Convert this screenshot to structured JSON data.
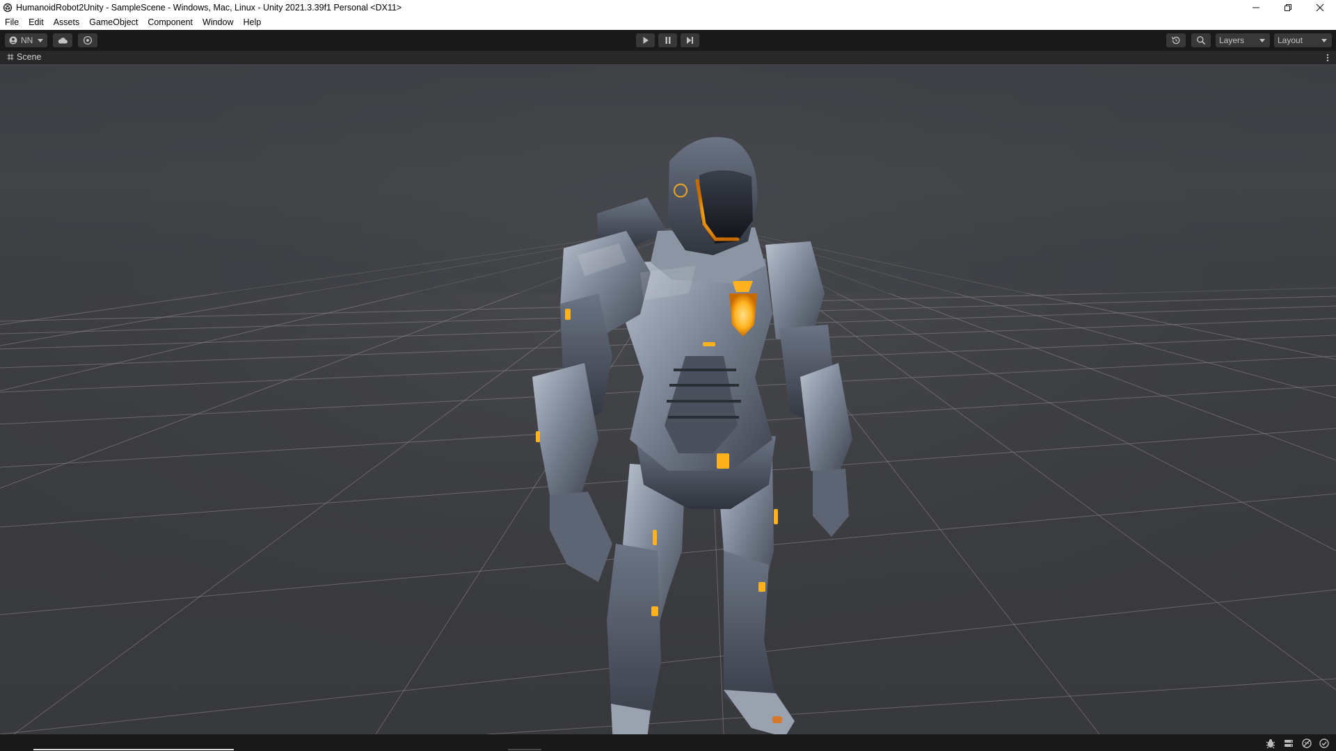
{
  "window": {
    "title": "HumanoidRobot2Unity - SampleScene - Windows, Mac, Linux - Unity 2021.3.39f1 Personal <DX11>"
  },
  "menu": {
    "items": [
      "File",
      "Edit",
      "Assets",
      "GameObject",
      "Component",
      "Window",
      "Help"
    ]
  },
  "toolbar": {
    "account_label": "NN",
    "layers_label": "Layers",
    "layout_label": "Layout"
  },
  "scene_tab": {
    "label": "Scene"
  },
  "colors": {
    "accent_glow": "#ffb21e",
    "editor_dark": "#191919",
    "viewport_bg": "#3a3b3f"
  }
}
